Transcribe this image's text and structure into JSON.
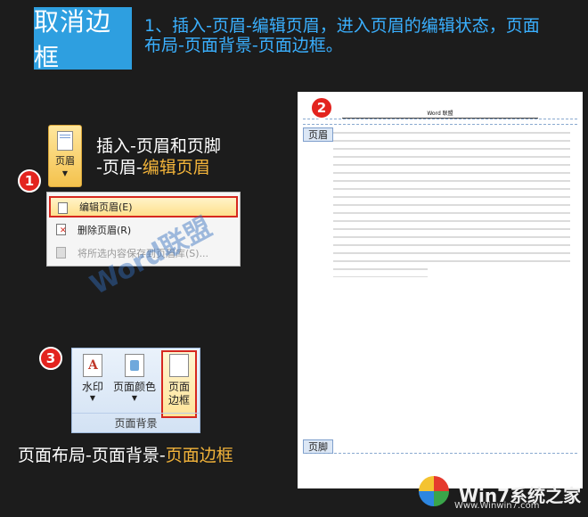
{
  "header": {
    "title": "取消边框",
    "step1_line1": "1、插入-页眉-编辑页眉，进入页眉的编辑状态，页面",
    "step1_line2": "布局-页面背景-页面边框。"
  },
  "ribbon_header": {
    "button_label": "页眉"
  },
  "instruction1": {
    "line1": "插入-页眉和页脚",
    "line2_prefix": "-页眉-",
    "line2_highlight": "编辑页眉"
  },
  "badges": {
    "one": "1",
    "two": "2",
    "three": "3"
  },
  "menu": {
    "items": [
      {
        "label": "编辑页眉(E)"
      },
      {
        "label": "删除页眉(R)"
      },
      {
        "label": "将所选内容保存到页眉库(S)..."
      }
    ]
  },
  "watermark": "Word联盟",
  "group": {
    "buttons": [
      {
        "label": "水印"
      },
      {
        "label": "页面颜色"
      },
      {
        "label": "页面边框"
      }
    ],
    "caption": "页面背景"
  },
  "instruction3": {
    "prefix": "页面布局-页面背景-",
    "highlight": "页面边框"
  },
  "document": {
    "header_text": "Word 联盟",
    "header_tag": "页眉",
    "footer_tag": "页脚"
  },
  "logo": {
    "text": "Win7系统之家",
    "url": "Www.Winwin7.com"
  }
}
